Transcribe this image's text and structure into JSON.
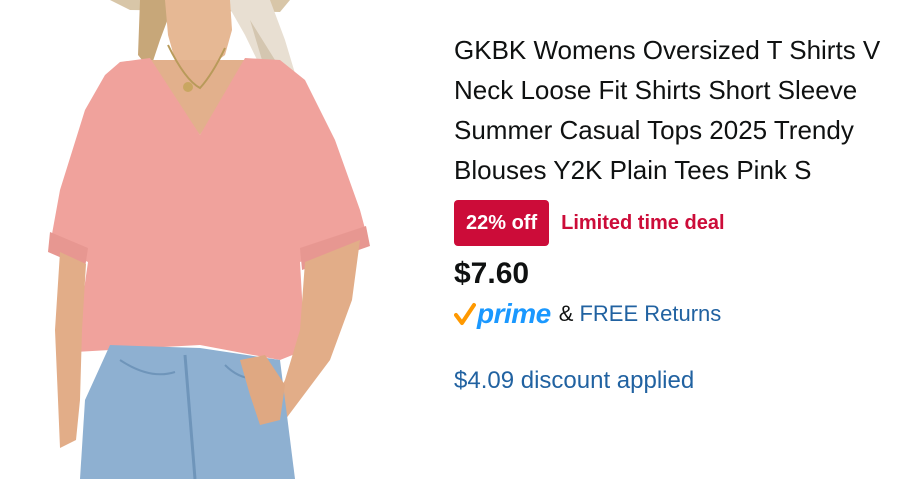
{
  "product": {
    "image_alt": "Woman wearing pink oversized V-neck t-shirt with jeans",
    "title": "GKBK Womens Oversized T Shirts V Neck Loose Fit Shirts Short Sleeve Summer Casual Tops 2025 Trendy Blouses Y2K Plain Tees Pink S",
    "discount_badge": "22% off",
    "deal_label": "Limited time deal",
    "price": "$7.60",
    "prime_label": "prime",
    "ampersand": "&",
    "returns_label": "FREE Returns",
    "discount_applied": "$4.09 discount applied"
  },
  "colors": {
    "deal_red": "#cc0c39",
    "prime_blue": "#1a98ff",
    "prime_check": "#ff9900",
    "link_blue": "#2162a1",
    "shirt_pink": "#f0a29c"
  },
  "icons": {
    "prime_check": "check-icon"
  }
}
